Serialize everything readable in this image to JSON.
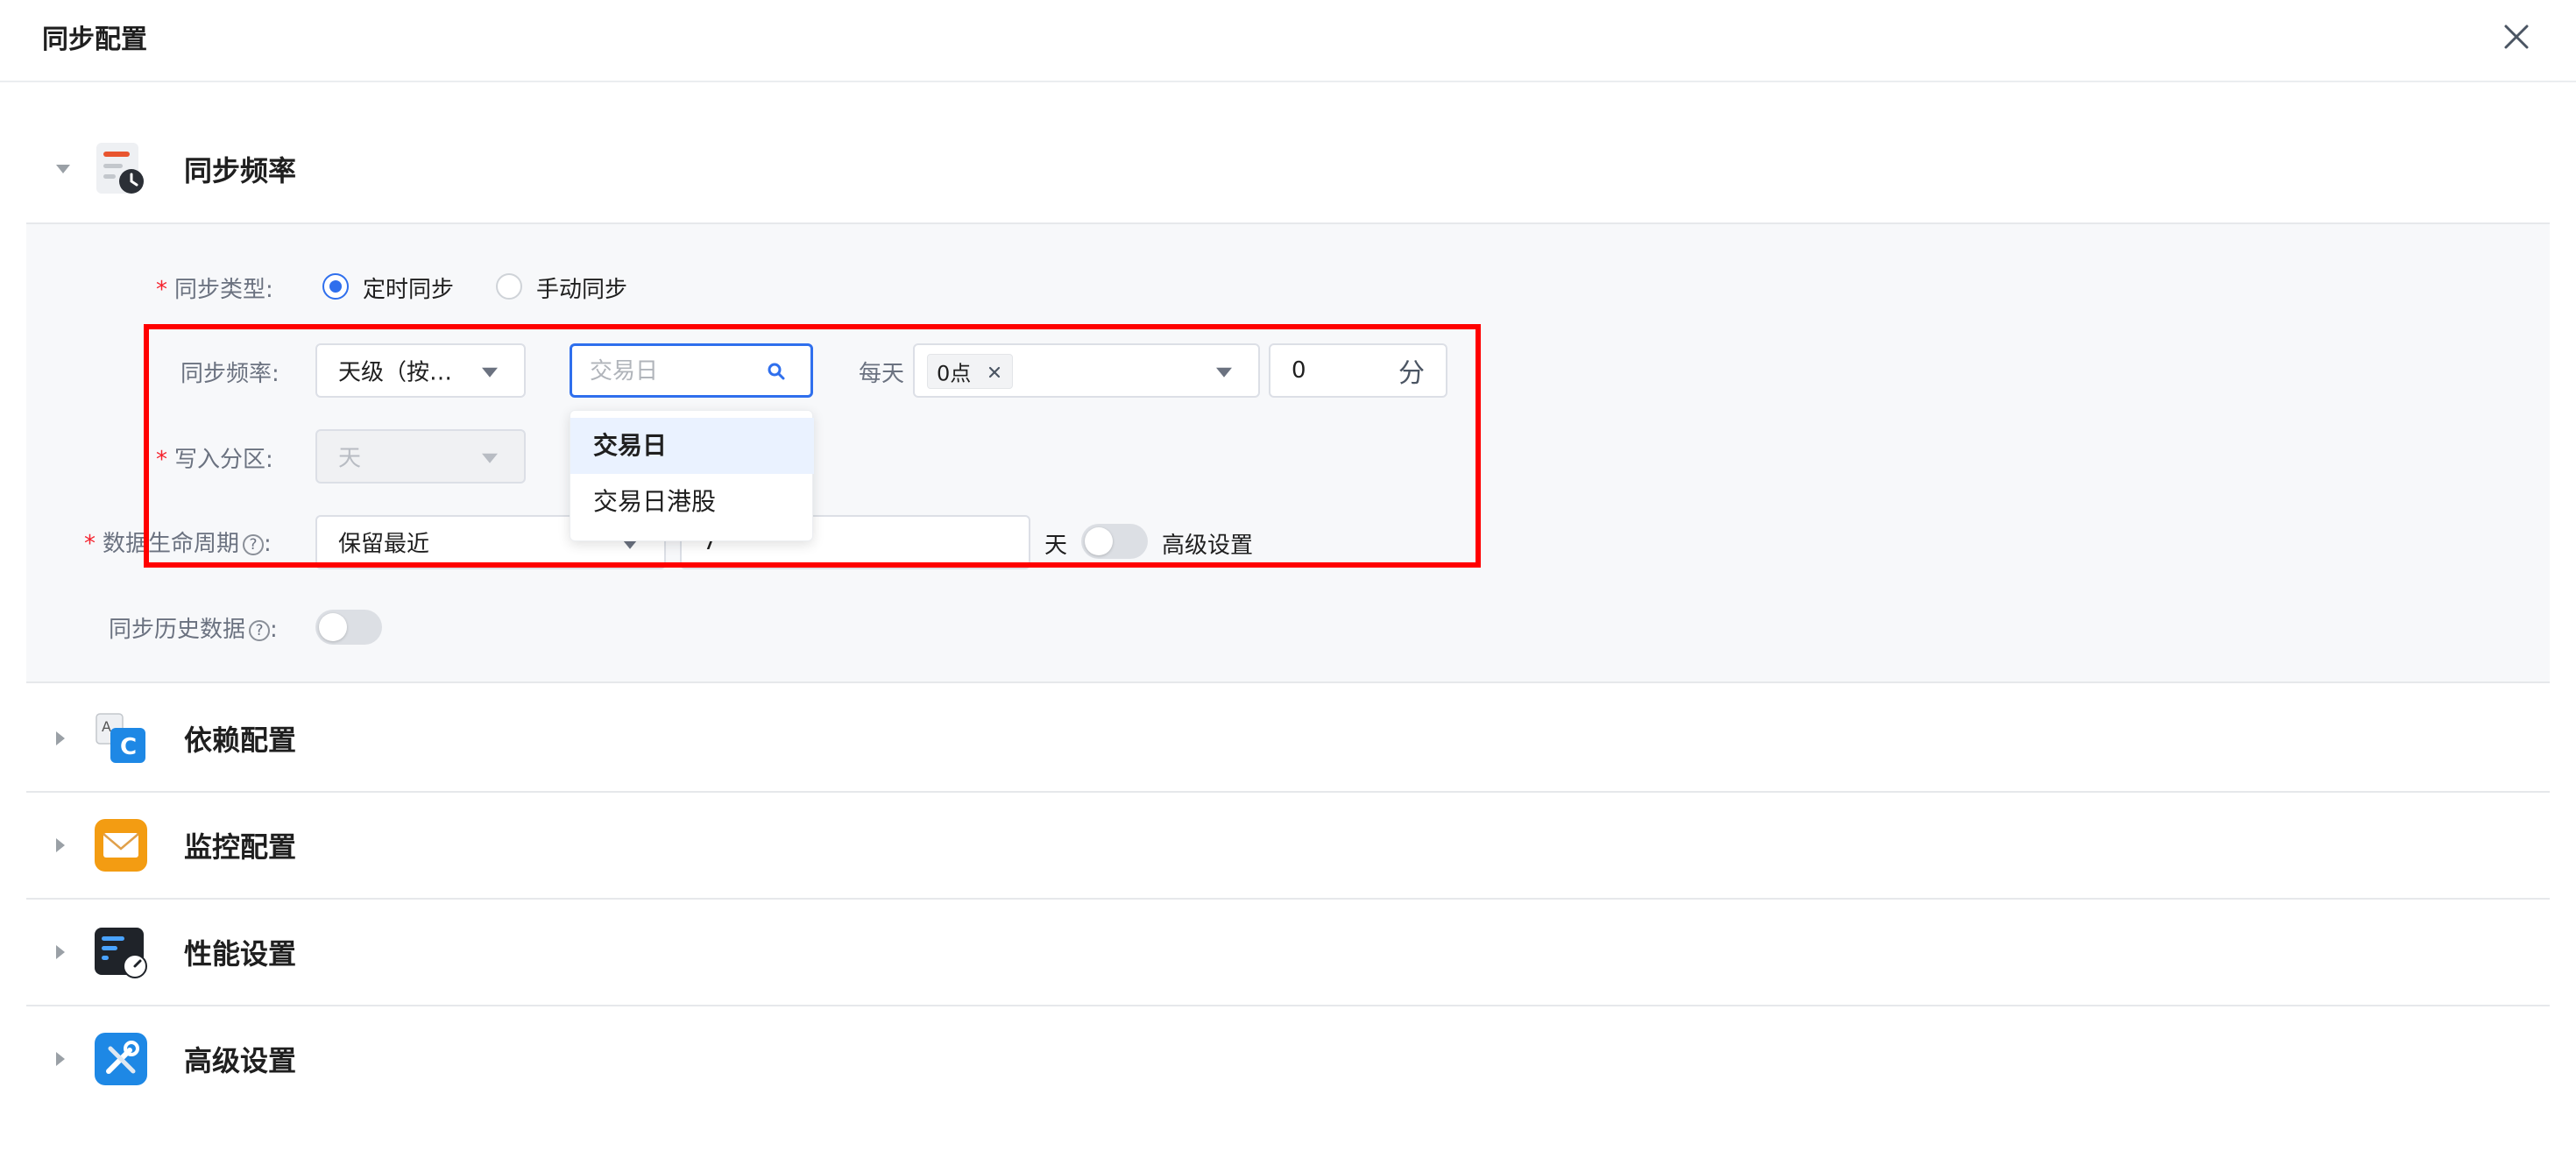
{
  "dialog": {
    "title": "同步配置"
  },
  "sections": {
    "sync_frequency": {
      "title": "同步频率"
    },
    "dependency": {
      "title": "依赖配置"
    },
    "monitor": {
      "title": "监控配置"
    },
    "performance": {
      "title": "性能设置"
    },
    "advanced": {
      "title": "高级设置"
    }
  },
  "form": {
    "sync_type": {
      "label": "同步类型:",
      "options": [
        "定时同步",
        "手动同步"
      ],
      "selected": "定时同步"
    },
    "sync_freq": {
      "label": "同步频率:",
      "level_value": "天级（按…",
      "search_placeholder": "交易日",
      "dropdown_options": [
        "交易日",
        "交易日港股"
      ],
      "daily_label": "每天",
      "hour_tag": "0点",
      "minute_value": "0",
      "minute_unit": "分"
    },
    "partition": {
      "label": "写入分区:",
      "value": "天"
    },
    "lifecycle": {
      "label": "数据生命周期",
      "mode_value": "保留最近",
      "days_value": "7",
      "days_unit": "天",
      "advanced_label": "高级设置"
    },
    "history": {
      "label": "同步历史数据"
    }
  },
  "colors": {
    "accent": "#2f6fed",
    "required": "#f5222d",
    "highlight": "#ff0000"
  }
}
